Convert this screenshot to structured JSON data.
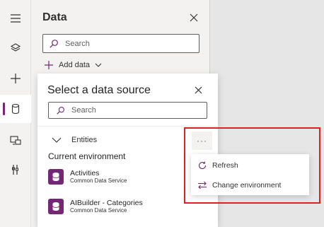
{
  "rail": {
    "items": [
      {
        "icon": "hamburger-menu-icon"
      },
      {
        "icon": "layers-icon"
      },
      {
        "icon": "plus-icon"
      },
      {
        "icon": "database-icon",
        "active": true
      },
      {
        "icon": "media-icon"
      },
      {
        "icon": "tools-icon"
      }
    ],
    "accent": "#742774"
  },
  "panel": {
    "title": "Data",
    "search_placeholder": "Search",
    "add_data_label": "Add data"
  },
  "flyout": {
    "title": "Select a data source",
    "search_placeholder": "Search",
    "group_label": "Entities",
    "section_label": "Current environment",
    "sources": [
      {
        "name": "Activities",
        "subtitle": "Common Data Service"
      },
      {
        "name": "AIBuilder - Categories",
        "subtitle": "Common Data Service"
      }
    ],
    "more_label": "···"
  },
  "context_menu": {
    "items": [
      {
        "label": "Refresh",
        "icon": "refresh-icon"
      },
      {
        "label": "Change environment",
        "icon": "switch-icon"
      }
    ]
  },
  "colors": {
    "highlight": "#e01f1f",
    "brand": "#742774"
  }
}
